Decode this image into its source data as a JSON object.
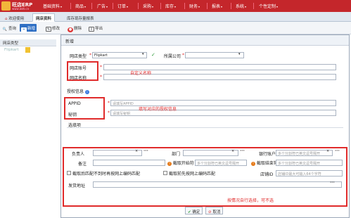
{
  "app": {
    "logo_text": "旺店ERP",
    "logo_sub": "www.wdt.cn"
  },
  "menu": [
    {
      "label": "基础资料",
      "caret": "▾"
    },
    {
      "label": "商品",
      "caret": "▾"
    },
    {
      "label": "广告",
      "caret": "▾"
    },
    {
      "label": "订单",
      "caret": "▾"
    },
    {
      "label": "采购",
      "caret": "▾"
    },
    {
      "label": "库存",
      "caret": "▾"
    },
    {
      "label": "财务",
      "caret": "▾"
    },
    {
      "label": "报表",
      "caret": "▾"
    },
    {
      "label": "系统",
      "caret": "▾"
    },
    {
      "label": "个性定制",
      "caret": "▾"
    }
  ],
  "tabs": [
    {
      "label": "欢迎使用"
    },
    {
      "label": "网店资料"
    },
    {
      "label": "库存现存量报表"
    }
  ],
  "toolbar": {
    "query": "查询",
    "add": "新增",
    "edit": "修改",
    "delete": "删除",
    "export": "导出"
  },
  "leftpanel": {
    "header": "网店类型",
    "row": "Flipkart"
  },
  "dialog": {
    "title": "新增",
    "shop_type_label": "网店类型",
    "shop_type_value": "Flipkart",
    "company_label": "所属公司",
    "shop_account_label": "网店账号",
    "shop_name_label": "网店名称",
    "custom_name_anno": "自定义名称",
    "auth_label": "授权信息",
    "appid_label": "APPID",
    "appid_placeholder": "请填写APPID",
    "secret_label": "秘钥",
    "secret_placeholder": "请填写秘钥",
    "auth_anno": "填写对应的授权信息",
    "options_label": "选填项",
    "person_label": "负责人",
    "dept_label": "部门",
    "bank_label": "银行账户",
    "bank_placeholder": "多个分割符已英文逗号隔开",
    "remark_label": "备注",
    "stop_start_label": "截取开始符",
    "stop_start_placeholder": "多个分割符已英文逗号隔开",
    "stop_end_label": "截取结束符",
    "stop_end_placeholder": "多个分割符已英文逗号隔开",
    "chk1_label": "截取后匹配不到时再按网上编码匹配",
    "chk2_label": "截取前先按网上编码匹配",
    "store_id_label": "店铺ID",
    "store_id_placeholder": "店铺ID最大可输入64个字符",
    "ship_addr_label": "发货地址",
    "options_anno": "按情况自行选择，可不选",
    "ok_label": "确定",
    "cancel_label": "取消"
  },
  "colors": {
    "brand": "#c4262b",
    "annotation": "#e02b2b",
    "ok": "#2e9a3a"
  }
}
